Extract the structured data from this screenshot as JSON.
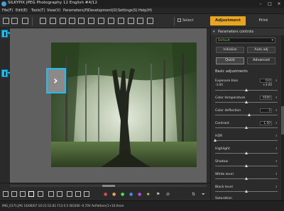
{
  "window": {
    "title": "SILKYPIX JPEG Photography 12 English   #4/12",
    "min_label": "–",
    "max_label": "□",
    "close_label": "×"
  },
  "menu": [
    {
      "label": "File(F)"
    },
    {
      "label": "Edit(E)"
    },
    {
      "label": "Tools(T)"
    },
    {
      "label": "View(V)"
    },
    {
      "label": "Parameters(P)"
    },
    {
      "label": "Development(D)"
    },
    {
      "label": "Settings(S)"
    },
    {
      "label": "Help(H)"
    }
  ],
  "toolbar": {
    "select_label": "Select",
    "adjustment_label": "Adjustment",
    "print_label": "Print"
  },
  "viewer": {
    "prev_arrow_glyph": "›"
  },
  "panel": {
    "header_label": "Parameters controls",
    "collapse_glyph": "▾",
    "preset_value": "Default",
    "preset_arrow": "▾",
    "initialize_label": "Initialize",
    "auto_adj_label": "Auto adj",
    "quick_label": "Quick",
    "advanced_label": "Advanced",
    "basic_title": "Basic adjustments",
    "params": [
      {
        "label": "Exposure bias",
        "value": "0.0",
        "sub_left": "-3.00",
        "sub_right": "+3.00",
        "level": 0.5
      },
      {
        "label": "Color temperature",
        "value": "6500",
        "level": 0.5
      },
      {
        "label": "Color deflection",
        "value": "3",
        "level": 0.55
      },
      {
        "label": "Contrast",
        "value": "1.50",
        "level": 0.5
      },
      {
        "label": "HDR",
        "value": "",
        "level": 0.0
      },
      {
        "label": "Highlight",
        "value": "",
        "level": 0.5
      },
      {
        "label": "Shadow",
        "value": "",
        "level": 0.5
      },
      {
        "label": "White level",
        "value": "",
        "level": 0.5
      },
      {
        "label": "Black level",
        "value": "",
        "level": 0.5
      },
      {
        "label": "Saturation",
        "value": "",
        "level": 0.5
      }
    ]
  },
  "status": {
    "text": "IMG_0171.JPG 14/06/07 10:21:52.81 F13 0.5 ISO200 -0.70V AvPattern(1+10.0mm"
  },
  "colors": {
    "accent_orange": "#e8a51f",
    "highlight_cyan": "#1dbef0",
    "preset_green": "#7fb85a"
  }
}
